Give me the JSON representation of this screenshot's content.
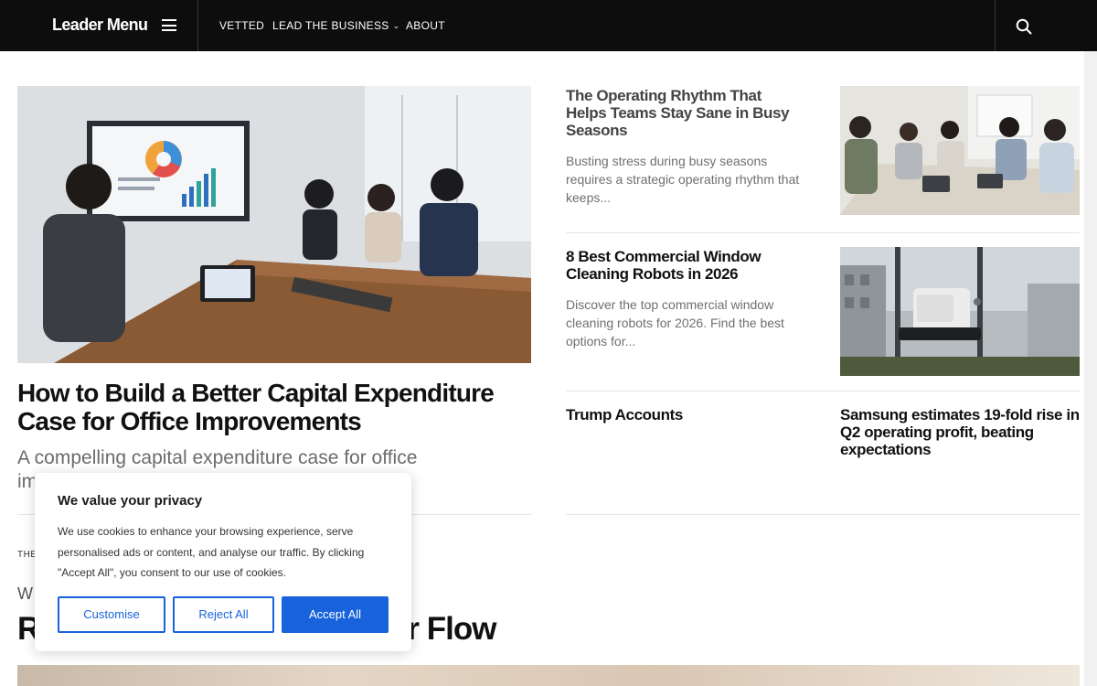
{
  "header": {
    "brand": "Leader Menu",
    "nav": [
      {
        "label": "VETTED"
      },
      {
        "label": "LEAD THE BUSINESS",
        "has_dropdown": true
      },
      {
        "label": "ABOUT"
      }
    ],
    "icons": [
      "hamburger-icon",
      "chevron-down-icon",
      "search-icon"
    ],
    "background": "#0d0d0d"
  },
  "featured": {
    "title": "How to Build a Better Capital Expenditure Case for Office Improvements",
    "excerpt_visible_start": "A compelling capital expenditure case for office",
    "excerpt_line2_start": "im"
  },
  "articles": [
    {
      "title": "The Operating Rhythm That Helps Teams Stay Sane in Busy Seasons",
      "excerpt": "Busting stress during busy seasons requires a strategic operating rhythm that keeps..."
    },
    {
      "title": "8 Best Commercial Window Cleaning Robots in 2026",
      "excerpt": "Discover the top commercial window cleaning robots for 2026. Find the best options for..."
    },
    {
      "title": "Trump Accounts",
      "excerpt": ""
    },
    {
      "title": "Samsung estimates 19-fold rise in Q2 operating profit, beating expectations",
      "excerpt": ""
    }
  ],
  "section_below": {
    "label_partial": "THE",
    "subtitle_partial": "W",
    "title_start": "R",
    "title_end": "ur Flow"
  },
  "cookie_banner": {
    "title": "We value your privacy",
    "body": "We use cookies to enhance your browsing experience, serve personalised ads or content, and analyse our traffic. By clicking \"Accept All\", you consent to our use of cookies.",
    "buttons": {
      "customise": "Customise",
      "reject": "Reject All",
      "accept": "Accept All"
    },
    "accent": "#1863dc"
  }
}
